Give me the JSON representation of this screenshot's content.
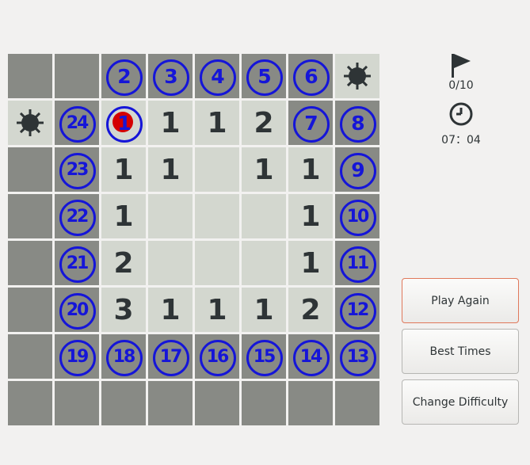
{
  "board": {
    "rows": 8,
    "cols": 8,
    "cells": [
      [
        "covered",
        "covered",
        "covered",
        "covered",
        "covered",
        "covered",
        "covered",
        "mine"
      ],
      [
        "mine",
        "covered",
        "open",
        "1",
        "1",
        "2",
        "covered",
        "covered"
      ],
      [
        "covered",
        "covered",
        "1",
        "1",
        "open",
        "1",
        "1",
        "covered"
      ],
      [
        "covered",
        "covered",
        "1",
        "open",
        "open",
        "open",
        "1",
        "covered"
      ],
      [
        "covered",
        "covered",
        "2",
        "open",
        "open",
        "open",
        "1",
        "covered"
      ],
      [
        "covered",
        "covered",
        "3",
        "1",
        "1",
        "1",
        "2",
        "covered"
      ],
      [
        "covered",
        "covered",
        "covered",
        "covered",
        "covered",
        "covered",
        "covered",
        "covered"
      ],
      [
        "covered",
        "covered",
        "covered",
        "covered",
        "covered",
        "covered",
        "covered",
        "covered"
      ]
    ],
    "annotations": [
      {
        "row": 0,
        "col": 2,
        "text": "2"
      },
      {
        "row": 0,
        "col": 3,
        "text": "3"
      },
      {
        "row": 0,
        "col": 4,
        "text": "4"
      },
      {
        "row": 0,
        "col": 5,
        "text": "5"
      },
      {
        "row": 0,
        "col": 6,
        "text": "6"
      },
      {
        "row": 1,
        "col": 1,
        "text": "24"
      },
      {
        "row": 1,
        "col": 2,
        "text": "1"
      },
      {
        "row": 1,
        "col": 6,
        "text": "7"
      },
      {
        "row": 1,
        "col": 7,
        "text": "8"
      },
      {
        "row": 2,
        "col": 1,
        "text": "23"
      },
      {
        "row": 2,
        "col": 7,
        "text": "9"
      },
      {
        "row": 3,
        "col": 1,
        "text": "22"
      },
      {
        "row": 3,
        "col": 7,
        "text": "10"
      },
      {
        "row": 4,
        "col": 1,
        "text": "21"
      },
      {
        "row": 4,
        "col": 7,
        "text": "11"
      },
      {
        "row": 5,
        "col": 1,
        "text": "20"
      },
      {
        "row": 5,
        "col": 7,
        "text": "12"
      },
      {
        "row": 6,
        "col": 1,
        "text": "19"
      },
      {
        "row": 6,
        "col": 2,
        "text": "18"
      },
      {
        "row": 6,
        "col": 3,
        "text": "17"
      },
      {
        "row": 6,
        "col": 4,
        "text": "16"
      },
      {
        "row": 6,
        "col": 5,
        "text": "15"
      },
      {
        "row": 6,
        "col": 6,
        "text": "14"
      },
      {
        "row": 6,
        "col": 7,
        "text": "13"
      }
    ],
    "red_mark": {
      "row": 1,
      "col": 2
    }
  },
  "status": {
    "flags": "0/10",
    "timer": "07：04"
  },
  "buttons": {
    "play_again": "Play Again",
    "best_times": "Best Times",
    "change_difficulty": "Change Difficulty"
  },
  "icons": {
    "flag": "flag-icon",
    "clock": "clock-icon",
    "mine": "mine-icon"
  },
  "colors": {
    "covered": "#888a85",
    "open": "#d3d7cf",
    "annotation": "#1515d8",
    "red_mark": "#d40000"
  }
}
